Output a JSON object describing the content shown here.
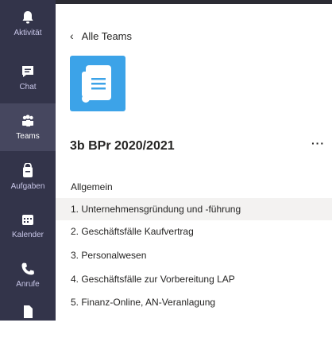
{
  "rail": {
    "items": [
      {
        "label": "Aktivität",
        "icon": "bell-icon"
      },
      {
        "label": "Chat",
        "icon": "chat-icon"
      },
      {
        "label": "Teams",
        "icon": "teams-icon"
      },
      {
        "label": "Aufgaben",
        "icon": "assignments-icon"
      },
      {
        "label": "Kalender",
        "icon": "calendar-icon"
      },
      {
        "label": "Anrufe",
        "icon": "phone-icon"
      },
      {
        "label": "",
        "icon": "files-icon"
      }
    ],
    "active": "Teams"
  },
  "back_label": "Alle Teams",
  "team": {
    "name": "3b BPr 2020/2021",
    "more": "···",
    "icon": "document-icon"
  },
  "channels": [
    "Allgemein",
    "1. Unternehmensgründung und -führung",
    "2. Geschäftsfälle Kaufvertrag",
    "3. Personalwesen",
    "4. Geschäftsfälle zur Vorbereitung LAP",
    "5. Finanz-Online, AN-Veranlagung"
  ],
  "active_channel": "1. Unternehmensgründung und -führung",
  "colors": {
    "rail_bg": "#33344a",
    "rail_active": "#46475f",
    "team_logo_bg": "#3ca3e8",
    "active_channel_bg": "#f3f2f1"
  }
}
